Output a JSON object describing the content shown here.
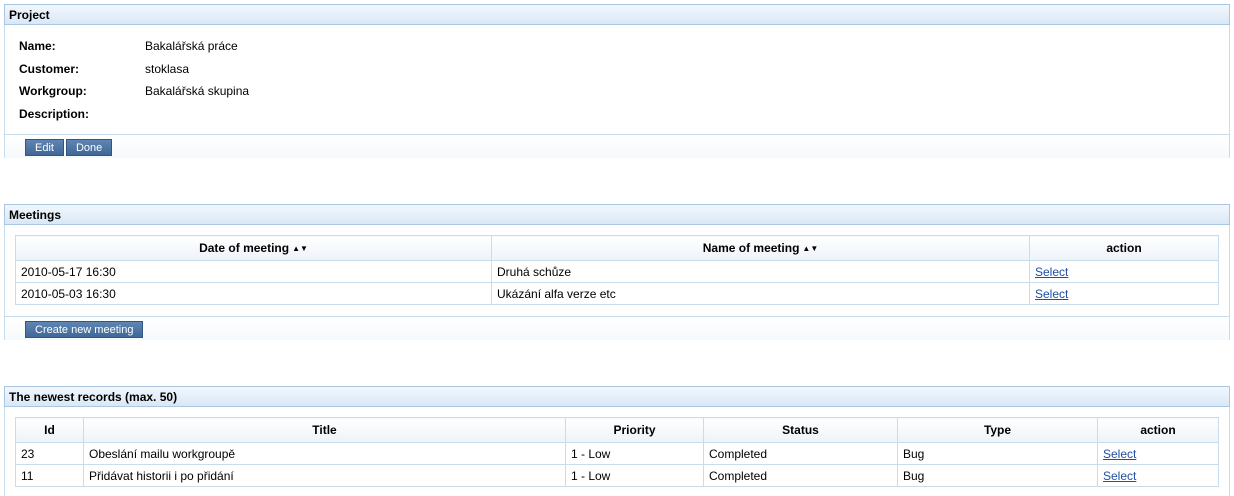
{
  "project": {
    "header": "Project",
    "fields": [
      {
        "label": "Name:",
        "value": "Bakalářská práce"
      },
      {
        "label": "Customer:",
        "value": "stoklasa"
      },
      {
        "label": "Workgroup:",
        "value": "Bakalářská skupina"
      },
      {
        "label": "Description:",
        "value": ""
      }
    ],
    "edit_label": "Edit",
    "done_label": "Done"
  },
  "meetings": {
    "header": "Meetings",
    "columns": {
      "date": "Date of meeting",
      "name": "Name of meeting",
      "action": "action"
    },
    "rows": [
      {
        "date": "2010-05-17 16:30",
        "name": "Druhá schůze",
        "action": "Select"
      },
      {
        "date": "2010-05-03 16:30",
        "name": "Ukázání alfa verze etc",
        "action": "Select"
      }
    ],
    "create_label": "Create new meeting"
  },
  "records": {
    "header": "The newest records (max. 50)",
    "columns": {
      "id": "Id",
      "title": "Title",
      "priority": "Priority",
      "status": "Status",
      "type": "Type",
      "action": "action"
    },
    "rows": [
      {
        "id": "23",
        "title": "Obeslání mailu workgroupě",
        "priority": "1 - Low",
        "status": "Completed",
        "type": "Bug",
        "action": "Select"
      },
      {
        "id": "11",
        "title": "Přidávat historii i po přidání",
        "priority": "1 - Low",
        "status": "Completed",
        "type": "Bug",
        "action": "Select"
      }
    ]
  },
  "icons": {
    "sort": "sort-arrows-icon"
  }
}
